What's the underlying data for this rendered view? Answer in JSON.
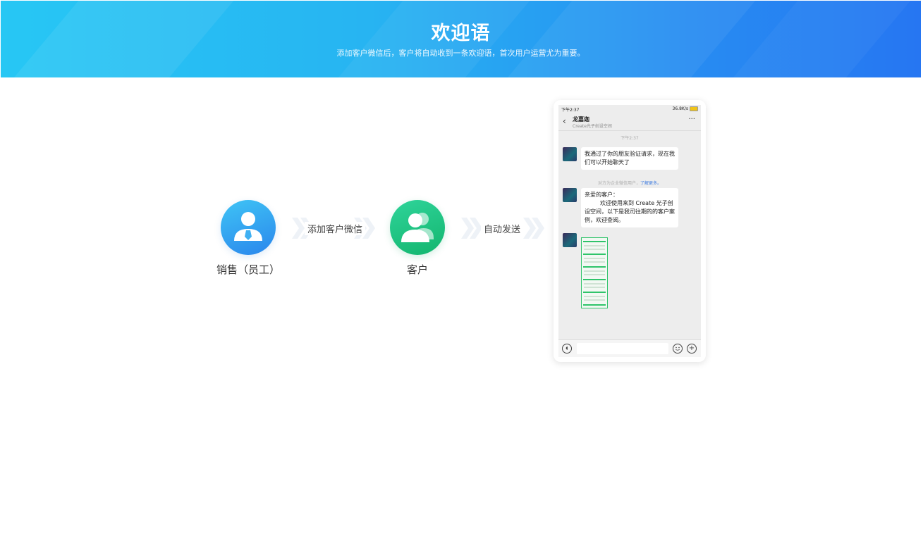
{
  "banner": {
    "title": "欢迎语",
    "subtitle": "添加客户微信后，客户将自动收到一条欢迎语，首次用户运营尤为重要。"
  },
  "flow": {
    "sales_label": "销售（员工）",
    "step1_label": "添加客户微信",
    "customer_label": "客户",
    "step2_label": "自动发送"
  },
  "phone": {
    "status_time": "下午2:37",
    "status_right": "36.8K/s",
    "chat_name": "龙嘉迦",
    "chat_sub": "Create光子创设空间",
    "msg_time": "下午2:37",
    "msg1": "我通过了你的朋友验证请求，现在我们可以开始聊天了",
    "note_text": "对方为企业微信用户，",
    "note_link": "了解更多。",
    "msg2_line1": "亲爱的客户：",
    "msg2_line2": "欢迎使用来到 Create 光子创设空间，以下是我司往期的的客户案例，欢迎查阅。"
  },
  "colors": {
    "banner_start": "#27c7f4",
    "banner_end": "#2676f2",
    "sales_blue": "#2a86ec",
    "customer_green": "#13b56e"
  }
}
